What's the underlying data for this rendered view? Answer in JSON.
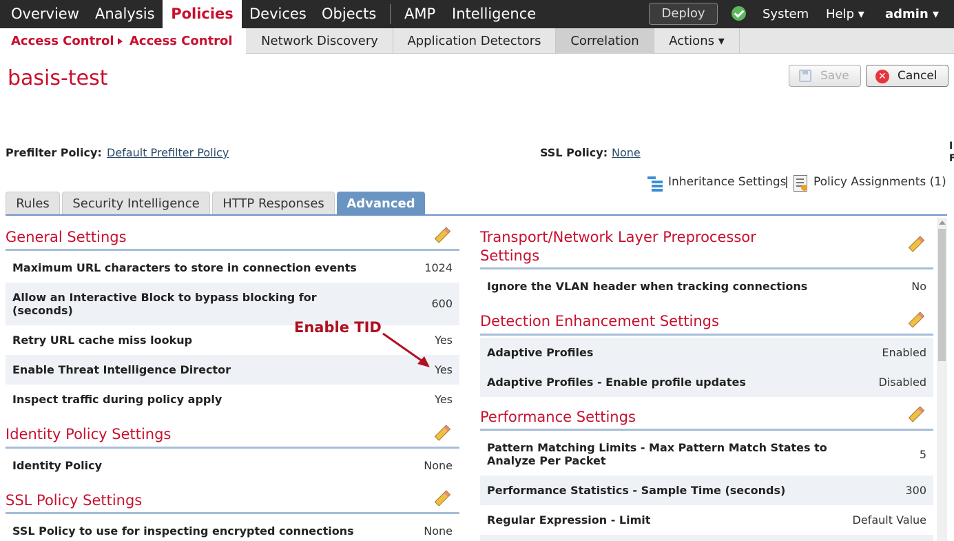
{
  "topnav": {
    "items": [
      "Overview",
      "Analysis",
      "Policies",
      "Devices",
      "Objects",
      "AMP",
      "Intelligence"
    ],
    "deploy": "Deploy",
    "system": "System",
    "help": "Help ▾",
    "user": "admin ▾"
  },
  "subnav": {
    "crumb1": "Access Control",
    "crumb2": "Access Control",
    "tabs": [
      "Network Discovery",
      "Application Detectors",
      "Correlation",
      "Actions ▾"
    ]
  },
  "page": {
    "title": "basis-test",
    "save": "Save",
    "cancel": "Cancel"
  },
  "policies": {
    "prefilter_label": "Prefilter Policy:",
    "prefilter_value": "Default Prefilter Policy",
    "ssl_label": "SSL Policy:",
    "ssl_value": "None",
    "edge_1": "I",
    "edge_2": "F",
    "inheritance": "Inheritance Settings",
    "divider": "|",
    "assignments": "Policy Assignments (1)"
  },
  "tabs": [
    "Rules",
    "Security Intelligence",
    "HTTP Responses",
    "Advanced"
  ],
  "left": {
    "general": {
      "title": "General Settings",
      "rows": [
        {
          "k": "Maximum URL characters to store in connection events",
          "v": "1024"
        },
        {
          "k": "Allow an Interactive Block to bypass blocking for",
          "k2": "(seconds)",
          "v": "600"
        },
        {
          "k": "Retry URL cache miss lookup",
          "v": "Yes"
        },
        {
          "k": "Enable Threat Intelligence Director",
          "v": "Yes"
        },
        {
          "k": "Inspect traffic during policy apply",
          "v": "Yes"
        }
      ]
    },
    "identity": {
      "title": "Identity Policy Settings",
      "rows": [
        {
          "k": "Identity Policy",
          "v": "None"
        }
      ]
    },
    "ssl": {
      "title": "SSL Policy Settings",
      "rows": [
        {
          "k": "SSL Policy to use for inspecting encrypted connections",
          "v": "None"
        }
      ]
    }
  },
  "right": {
    "transport": {
      "title1": "Transport/Network Layer Preprocessor",
      "title2": "Settings",
      "rows": [
        {
          "k": "Ignore the VLAN header when tracking connections",
          "v": "No"
        }
      ]
    },
    "detection": {
      "title": "Detection Enhancement Settings",
      "rows": [
        {
          "k": "Adaptive Profiles",
          "v": "Enabled"
        },
        {
          "k": "Adaptive Profiles - Enable profile updates",
          "v": "Disabled"
        }
      ]
    },
    "performance": {
      "title": "Performance Settings",
      "rows": [
        {
          "k": "Pattern Matching Limits - Max Pattern Match States to",
          "k2": "Analyze Per Packet",
          "v": "5"
        },
        {
          "k": "Performance Statistics - Sample Time (seconds)",
          "v": "300"
        },
        {
          "k": "Regular Expression - Limit",
          "v": "Default Value"
        }
      ]
    }
  },
  "annotation": "Enable TID",
  "colors": {
    "brand": "#c8102e",
    "tab_active": "#6a95c3",
    "nav_bg": "#2a2a2a"
  }
}
